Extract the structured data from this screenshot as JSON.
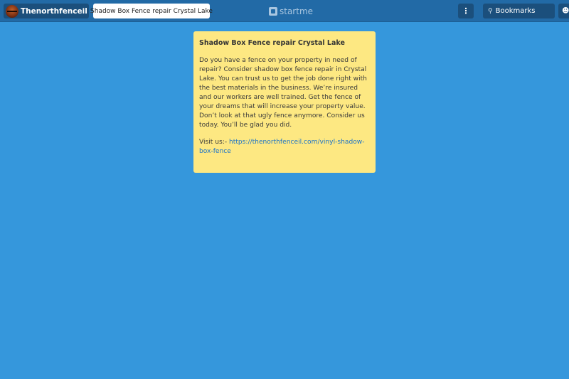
{
  "header": {
    "user_name": "Thenorthfenceil",
    "page_name": "Shadow Box Fence repair Crystal Lake",
    "brand": "startme",
    "bookmarks_label": "Bookmarks"
  },
  "card": {
    "title": "Shadow Box Fence repair Crystal Lake",
    "body": "Do you have a fence on your property in need of repair? Consider shadow box fence repair in Crystal Lake. You can trust us to get the job done right with the best materials in the business. We’re insured and our workers are well trained. Get the fence of your dreams that will increase your property value. Don’t look at that ugly fence anymore. Consider us today. You’ll be glad you did.",
    "visit_prefix": "Visit us:- ",
    "link_text": "https://thenorthfenceil.com/vinyl-shadow-box-fence",
    "link_href": "https://thenorthfenceil.com/vinyl-shadow-box-fence"
  },
  "colors": {
    "background": "#3597dc",
    "topbar": "#226aa6",
    "card": "#fde882",
    "link": "#1c73c7"
  },
  "icons": [
    "chevron-down-icon",
    "more-vertical-icon",
    "search-icon",
    "user-icon",
    "startme-logo-icon"
  ]
}
